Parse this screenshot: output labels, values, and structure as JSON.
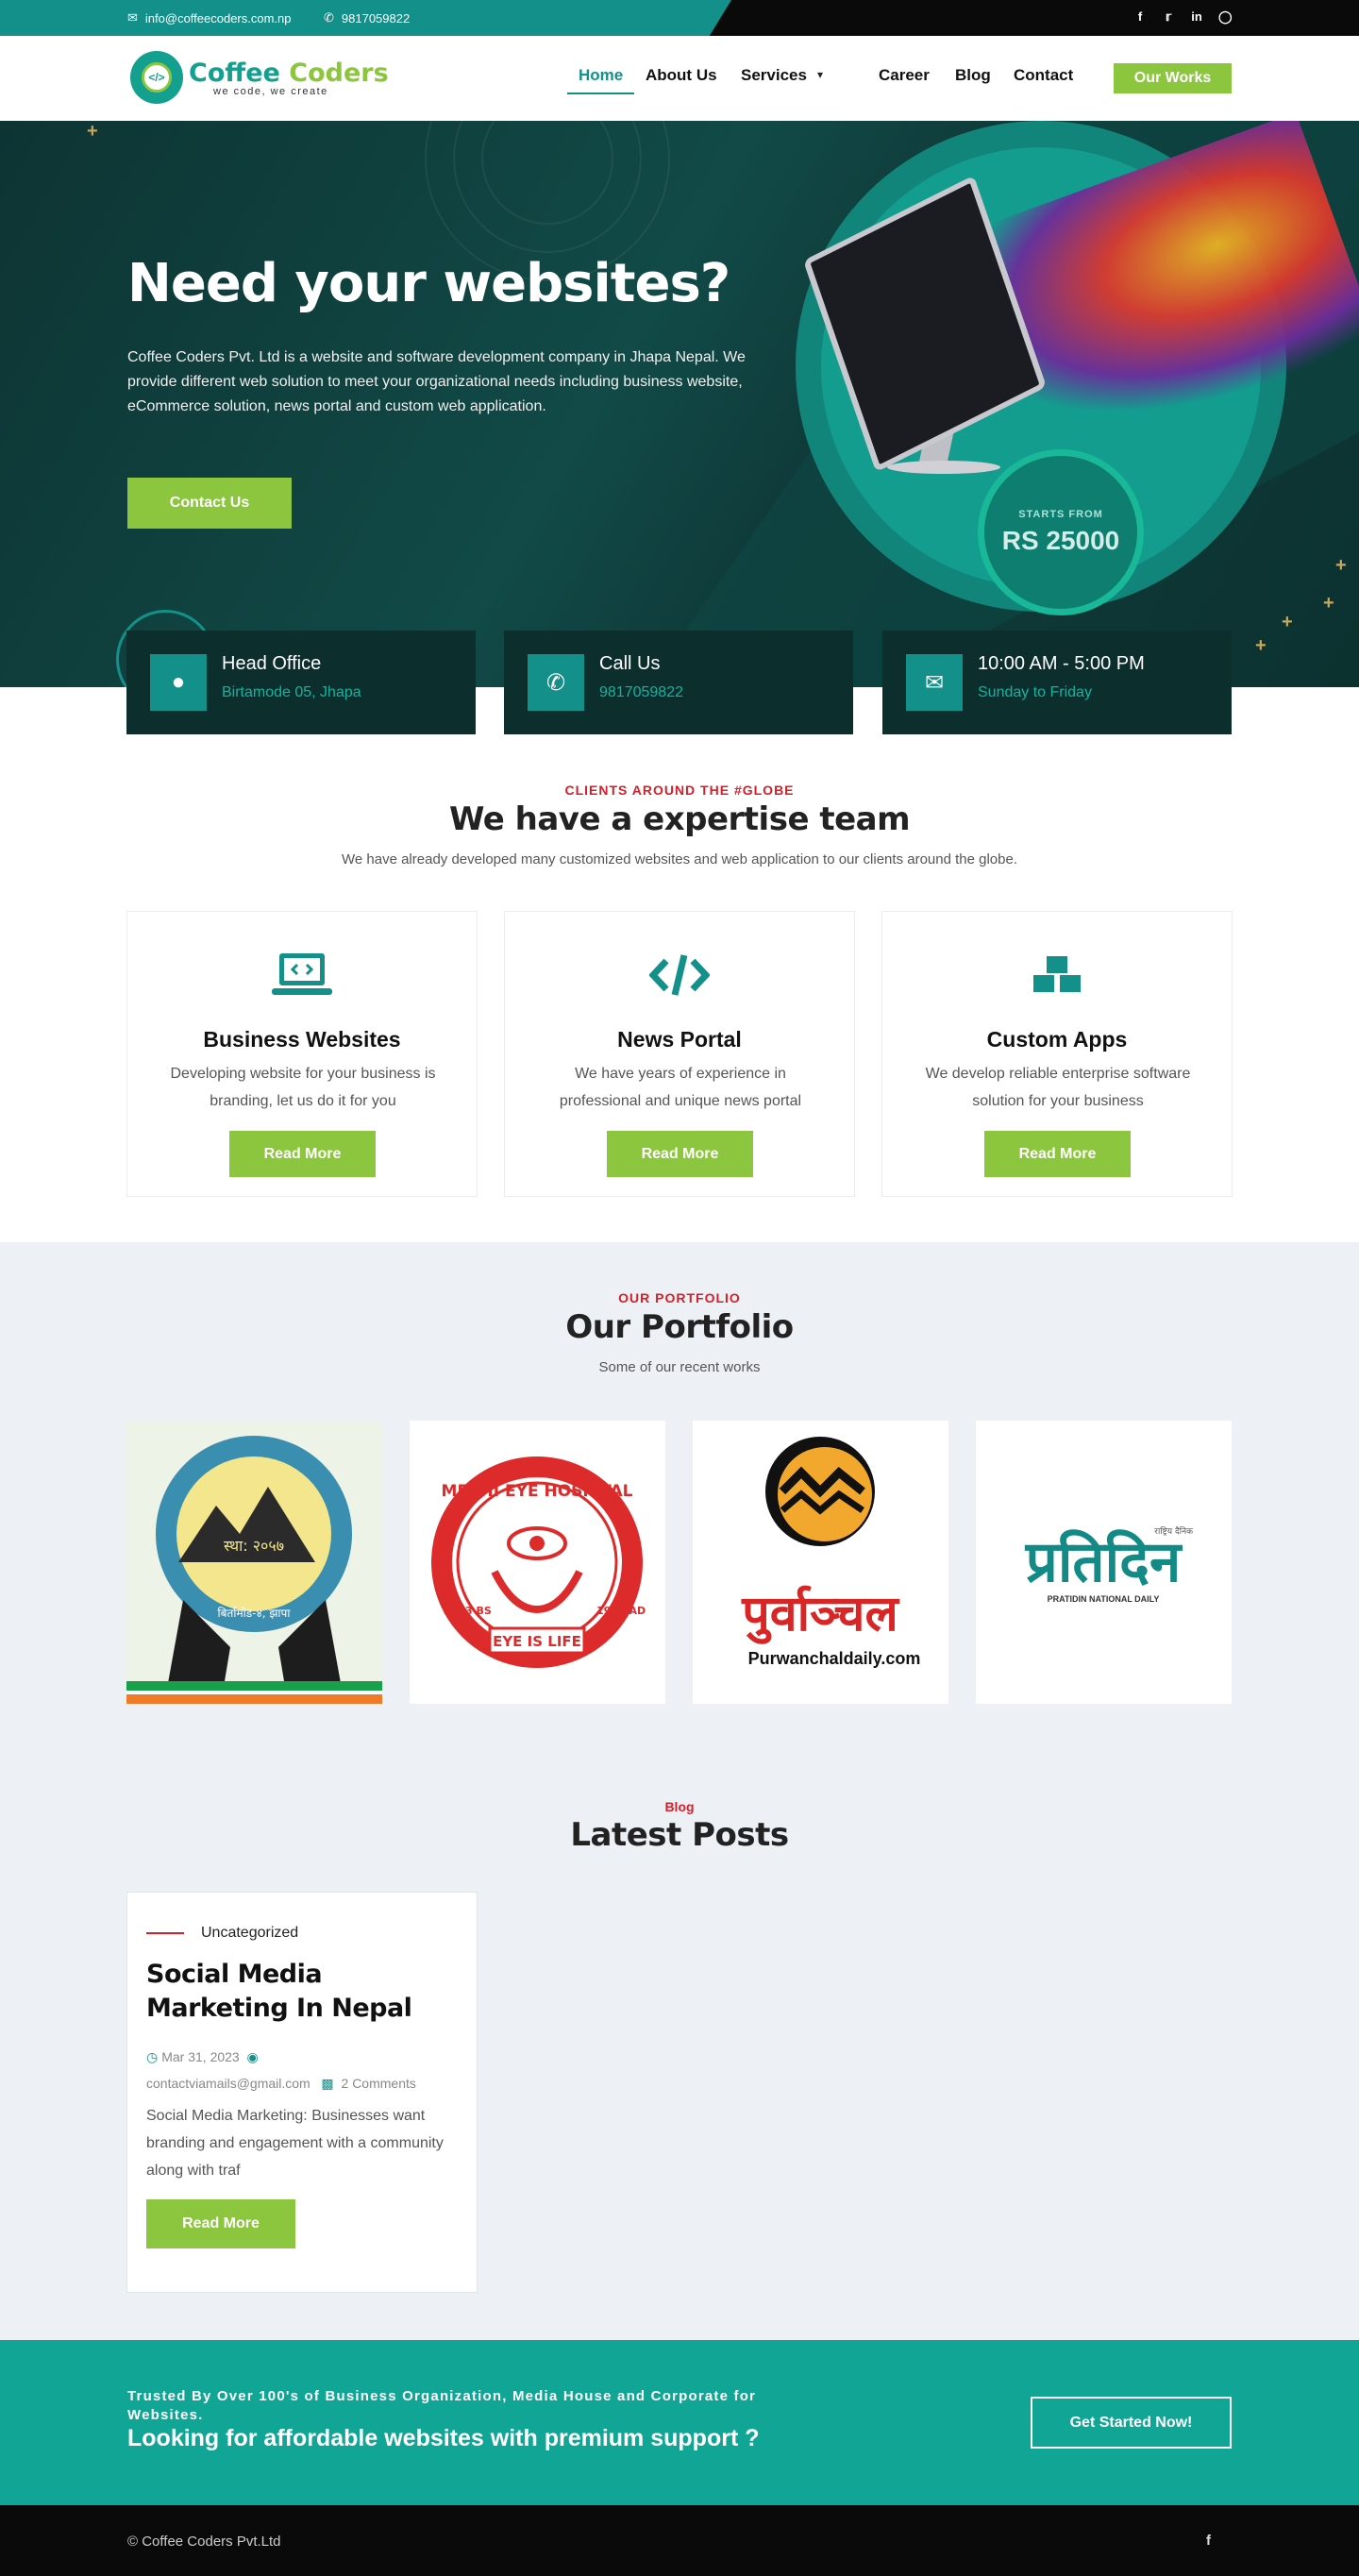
{
  "topbar": {
    "email": "info@coffeecoders.com.np",
    "phone": "9817059822",
    "social_icons": [
      "facebook-icon",
      "twitter-icon",
      "linkedin-icon",
      "instagram-icon"
    ]
  },
  "header": {
    "logo_part1": "Coffee",
    "logo_part2": "Coders",
    "logo_tagline": "we code, we create",
    "nav": [
      {
        "label": "Home",
        "active": true
      },
      {
        "label": "About Us"
      },
      {
        "label": "Services"
      },
      {
        "label": "Career"
      },
      {
        "label": "Blog"
      },
      {
        "label": "Contact"
      }
    ],
    "cta_label": "Our Works"
  },
  "hero": {
    "title": "Need your websites?",
    "description": "Coffee Coders Pvt. Ltd is a website and software development company in Jhapa Nepal. We provide different web solution to meet your organizational needs including business website, eCommerce solution, news portal and custom web application.",
    "button_label": "Contact Us",
    "price_label": "STARTS FROM",
    "price_value": "RS 25000"
  },
  "info_cards": [
    {
      "icon": "map-pin-icon",
      "title": "Head Office",
      "subtitle": "Birtamode 05, Jhapa"
    },
    {
      "icon": "phone-icon",
      "title": "Call Us",
      "subtitle": "9817059822"
    },
    {
      "icon": "envelope-open-icon",
      "title": "10:00 AM - 5:00 PM",
      "subtitle": "Sunday to Friday"
    }
  ],
  "expertise": {
    "kicker": "CLIENTS AROUND THE #GLOBE",
    "title": "We have a expertise team",
    "subtitle": "We have already developed many customized websites and web application to our clients around the globe.",
    "services": [
      {
        "icon": "laptop-code-icon",
        "title": "Business Websites",
        "description": "Developing website for your business is branding, let us do it for you",
        "button": "Read More"
      },
      {
        "icon": "code-icon",
        "title": "News Portal",
        "description": "We have years of experience in professional and unique news portal",
        "button": "Read More"
      },
      {
        "icon": "cubes-icon",
        "title": "Custom Apps",
        "description": "We develop reliable enterprise software solution for your business",
        "button": "Read More"
      }
    ]
  },
  "portfolio": {
    "kicker": "OUR PORTFOLIO",
    "title": "Our Portfolio",
    "subtitle": "Some of our recent works",
    "items": [
      {
        "name": "cooperative-logo",
        "text1": "स्था: २०५७",
        "text2": "बिर्तामोड-४, झापा"
      },
      {
        "name": "mechi-eye-hospital-logo",
        "text1": "MECHI EYE HOSPITAL",
        "text2": "EYE IS LIFE",
        "year1": "2053 BS",
        "year2": "1996 AD"
      },
      {
        "name": "purwanchal-daily-logo",
        "text1": "पुर्वाञ्चल",
        "text2": "Purwanchaldaily.com"
      },
      {
        "name": "pratidin-logo",
        "text1": "प्रतिदिन",
        "text2": "PRATIDIN NATIONAL DAILY",
        "text3": "राष्ट्रिय दैनिक"
      }
    ]
  },
  "blog": {
    "kicker": "Blog",
    "title": "Latest Posts",
    "posts": [
      {
        "category": "Uncategorized",
        "title": "Social Media Marketing In Nepal",
        "date": "Mar 31, 2023",
        "author": "contactviamails@gmail.com",
        "comments": "2 Comments",
        "excerpt": "Social Media Marketing: Businesses want branding and engagement with a community along with traf",
        "button": "Read More"
      }
    ]
  },
  "cta": {
    "small": "Trusted By Over 100's of Business Organization, Media House and Corporate for Websites.",
    "big": "Looking for affordable websites with premium support ?",
    "button": "Get Started Now!"
  },
  "footer": {
    "copyright": "© Coffee Coders Pvt.Ltd",
    "social_icon": "facebook-icon"
  }
}
